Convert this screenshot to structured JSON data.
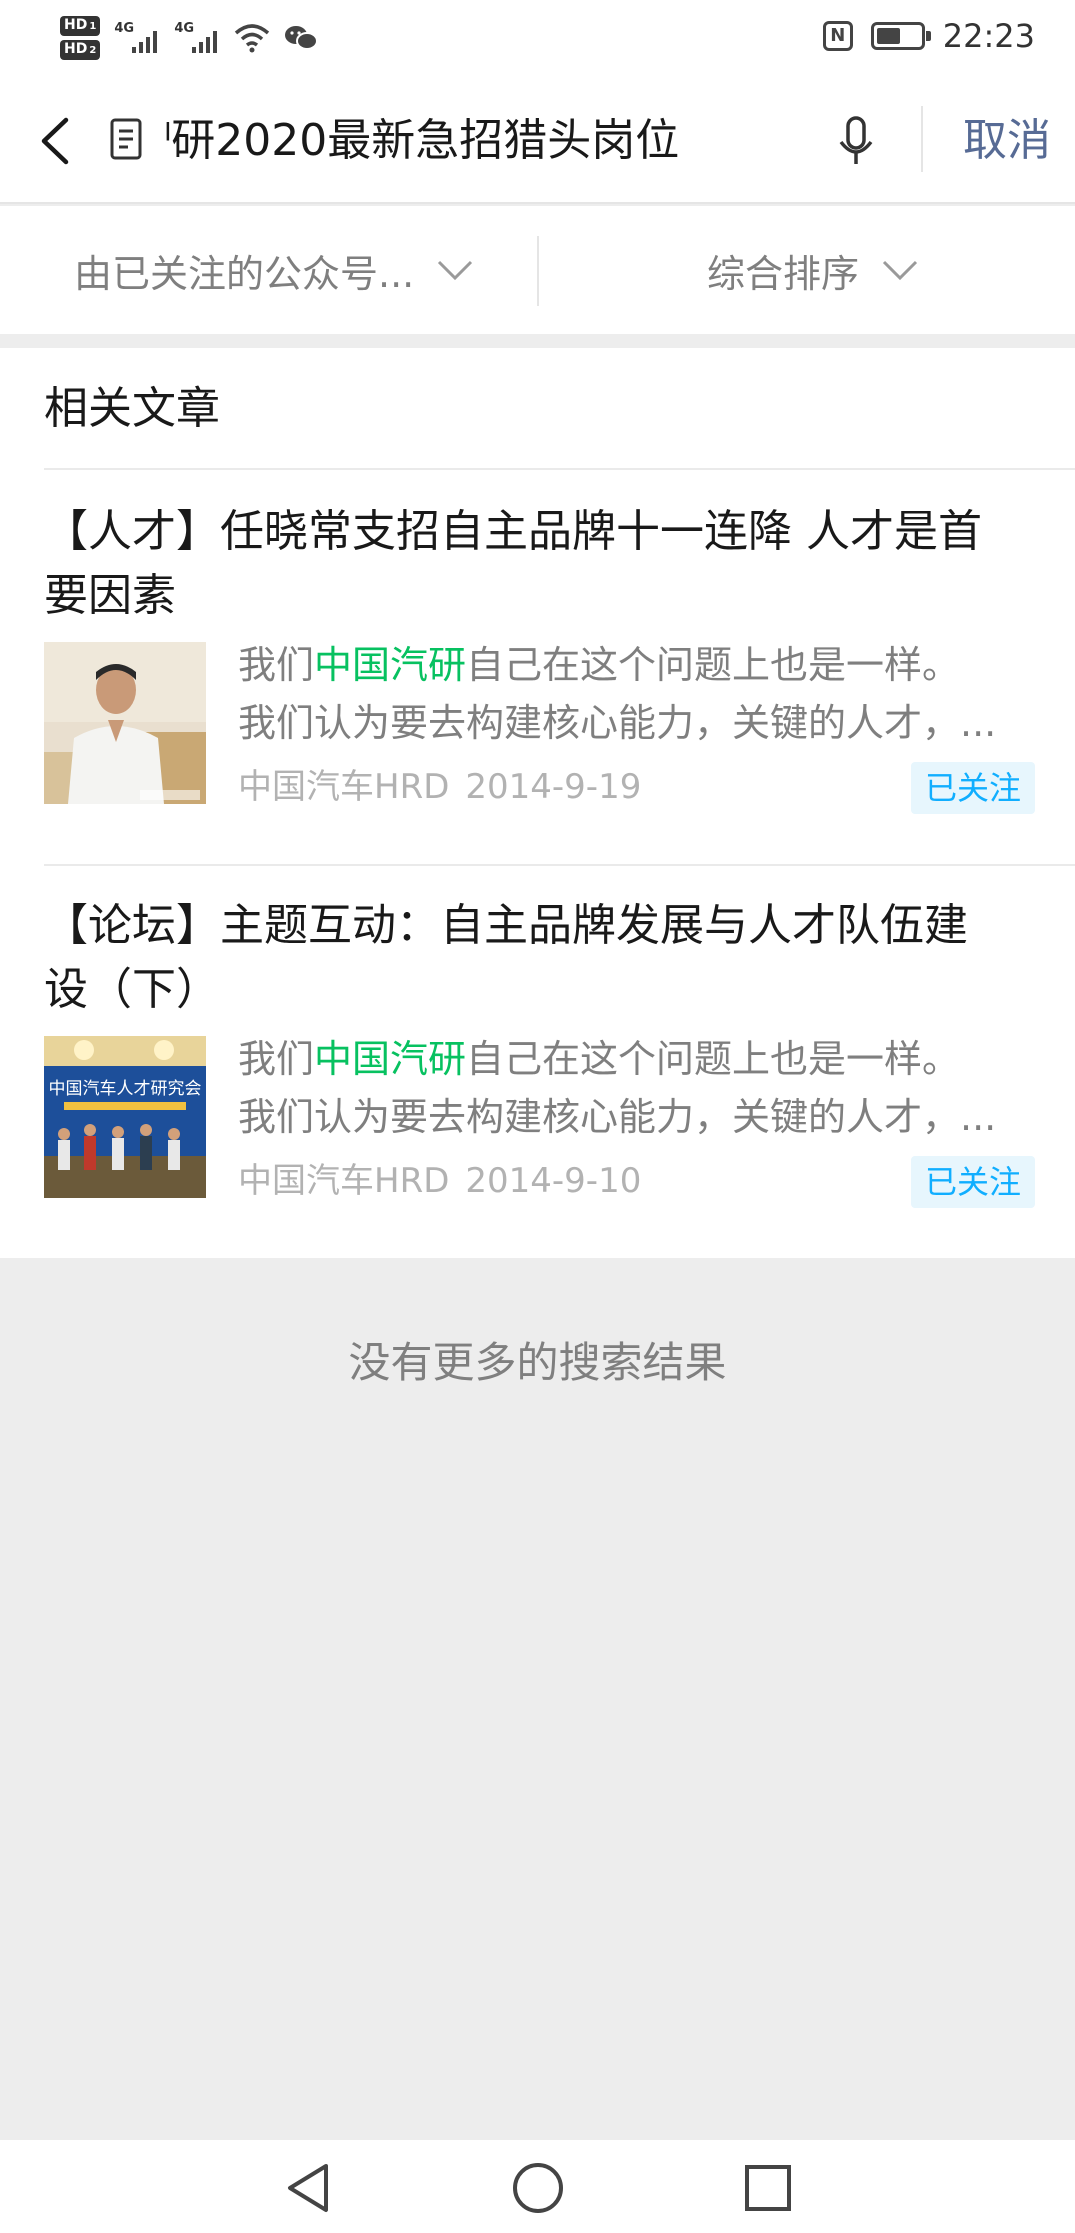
{
  "status_bar": {
    "hd1": "HD",
    "hd1_sub": "1",
    "hd2": "HD",
    "hd2_sub": "2",
    "net1": "4G",
    "net2": "4G",
    "nfc": "N",
    "battery_level": 0.55,
    "time": "22:23",
    "icons": [
      "signal-icon",
      "wifi-icon",
      "wechat-icon",
      "nfc-icon",
      "battery-icon"
    ]
  },
  "search": {
    "query": "ˡ研2020最新急招猎头岗位",
    "cancel_label": "取消",
    "icons": [
      "back-icon",
      "document-icon",
      "microphone-icon"
    ]
  },
  "filters": {
    "source_label": "由已关注的公众号...",
    "sort_label": "综合排序"
  },
  "results": {
    "section_title": "相关文章",
    "articles": [
      {
        "title_line1": "【人才】任晓常支招自主品牌十一连降 人才是首",
        "title_line2": "要因素",
        "snippet_pre": "我们",
        "snippet_hl": "中国汽研",
        "snippet_post": "自己在这个问题上也是一样。",
        "snippet_line2": "我们认为要去构建核心能力，关键的人才，...",
        "source": "中国汽车HRD",
        "date": "2014-9-19",
        "followed_label": "已关注"
      },
      {
        "title_line1": "【论坛】主题互动：自主品牌发展与人才队伍建",
        "title_line2": "设（下）",
        "snippet_pre": "我们",
        "snippet_hl": "中国汽研",
        "snippet_post": "自己在这个问题上也是一样。",
        "snippet_line2": "我们认为要去构建核心能力，关键的人才，...",
        "source": "中国汽车HRD",
        "date": "2014-9-10",
        "followed_label": "已关注",
        "thumb_text": "中国汽车人才研究会"
      }
    ],
    "no_more": "没有更多的搜索结果"
  },
  "colors": {
    "highlight": "#07c160",
    "link": "#576b95",
    "followed_text": "#10aeff",
    "followed_bg": "#e7f6fd"
  }
}
